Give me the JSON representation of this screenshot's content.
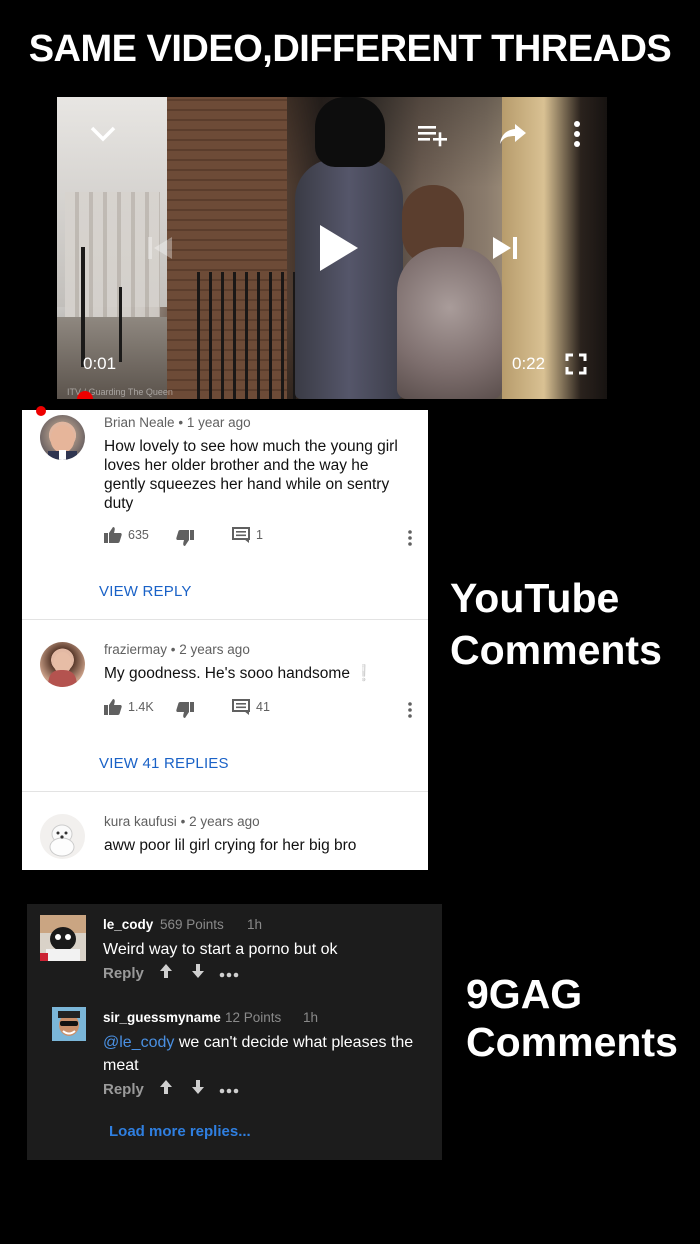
{
  "header": {
    "title": "SAME VIDEO,DIFFERENT THREADS"
  },
  "video": {
    "current_time": "0:01",
    "duration": "0:22",
    "watermark": "ITV / Guarding The Queen",
    "icons": {
      "collapse": "chevron-down-icon",
      "add_to_queue": "add-to-queue-icon",
      "share": "share-icon",
      "more": "more-vertical-icon",
      "previous": "previous-icon",
      "play": "play-icon",
      "next": "next-icon",
      "fullscreen": "fullscreen-icon"
    }
  },
  "youtube": {
    "label_line1": "YouTube",
    "label_line2": "Comments",
    "comments": [
      {
        "author": "Brian Neale",
        "age": "1 year ago",
        "text": "How lovely to see how much the young girl loves her older brother and the  way he gently squeezes her hand while on sentry duty",
        "likes": "635",
        "replies_count": "1",
        "view_replies": "VIEW REPLY"
      },
      {
        "author": "fraziermay",
        "age": "2 years ago",
        "text": "My goodness. He's sooo handsome",
        "emoji": "❕",
        "likes": "1.4K",
        "replies_count": "41",
        "view_replies": "VIEW 41 REPLIES"
      },
      {
        "author": "kura kaufusi",
        "age": "2 years ago",
        "text": "aww poor lil girl crying for her big bro"
      }
    ],
    "separator": "•"
  },
  "ninegag": {
    "label_line1": "9GAG",
    "label_line2": "Comments",
    "comments": [
      {
        "user": "le_cody",
        "points": "569 Points",
        "time": "1h",
        "text": "Weird way to start a porno but ok",
        "reply_label": "Reply"
      },
      {
        "user": "sir_guessmyname",
        "points": "12 Points",
        "time": "1h",
        "mention": "@le_cody",
        "text": " we can't decide what pleases the meat",
        "reply_label": "Reply"
      }
    ],
    "load_more": "Load more replies..."
  },
  "colors": {
    "background": "#000000",
    "youtube_link": "#1a62c7",
    "ninegag_panel": "#1c1c1c",
    "ninegag_link": "#2f7fe0",
    "ninegag_mention": "#4a90e2"
  }
}
